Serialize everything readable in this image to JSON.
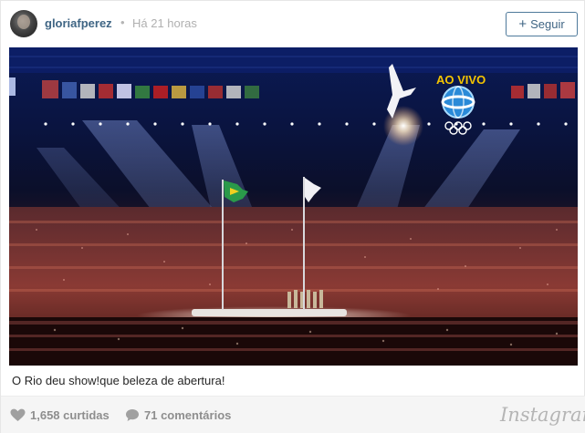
{
  "post": {
    "username": "gloriafperez",
    "separator": "•",
    "time": "Há 21 horas",
    "follow_label": "Seguir",
    "follow_icon": "+"
  },
  "photo": {
    "overlay_text": "AO VIVO",
    "broadcaster_logo": "globe-broadcast-logo",
    "rings_icon": "olympic-rings-icon"
  },
  "caption": "O Rio deu show!que beleza de abertura!",
  "footer": {
    "likes": "1,658 curtidas",
    "comments": "71 comentários",
    "brand": "Instagram"
  },
  "colors": {
    "username": "#3f6584",
    "muted": "#b0b0b0",
    "footer_bg": "#f5f5f5",
    "ao_vivo": "#f5c400"
  }
}
